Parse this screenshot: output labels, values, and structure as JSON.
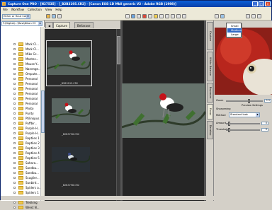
{
  "window": {
    "title": "Capture One PRO - [N27535] - [_B2B3195.CR2] - [Canon EOS-1D Mkll generic V2 - Adobe RGB (1998)]",
    "controls": [
      "_",
      "□",
      "×"
    ]
  },
  "menu": [
    "File",
    "Workflow",
    "Collection",
    "View",
    "Help"
  ],
  "toolbar": {
    "filter_combo": "Either or Hout Call",
    "right_combo": "Medium"
  },
  "left_panel": {
    "path_combo": "F:\\Digital\\...\\Raw\\Nikon 23",
    "folders": [
      "Mark Cl...",
      "Mark Cl...",
      "Mike Gr...",
      "Montes...",
      "Mouse-Y...",
      "Nanenge...",
      "Ompute...",
      "Personal",
      "Personal",
      "Personal",
      "Personal",
      "Personal",
      "Personal",
      "Photo",
      "Purity",
      "Ptilinopus",
      "Puffbir...",
      "Purple H...",
      "Purple H...",
      "Reptiles 1",
      "Reptiles 2",
      "Reptiles 3",
      "Reptiles 4",
      "Reptiles 5",
      "Sahara...",
      "Sandbu...",
      "Sandbu...",
      "Scuglier...",
      "Sunbird...",
      "Spiders a...",
      "Spiders 1",
      "Trekking",
      "Trekking",
      "Wrest N..."
    ]
  },
  "browser": {
    "tabs": [
      "Capture",
      "Bellarase"
    ],
    "thumbnails": [
      {
        "caption": "_B2B3195.CR2",
        "selected": true
      },
      {
        "caption": "_B2B3796.CR2",
        "selected": false
      },
      {
        "caption": "_B2B3798.CR2",
        "selected": false
      }
    ]
  },
  "right_panel": {
    "vertical_tabs": [
      "Capture",
      "White Balance",
      "Exposure",
      "Focus",
      "Develop"
    ],
    "dropdown": {
      "items": [
        "Small",
        "Medium",
        "Large"
      ],
      "highlighted": 1
    },
    "zoom_label": "Zoom",
    "zoom_value": "1:1",
    "sharpening_label": "Sharpening",
    "preview_settings": "Preview Settings",
    "method_label": "Method",
    "method_value": "Standard look",
    "amount_label": "Amount",
    "amount_value": "0",
    "threshold_label": "Threshold",
    "threshold_value": "0"
  },
  "colors": {
    "titlebar": "#0a3fa8",
    "folder": "#f0c850",
    "highlight": "#316ac5",
    "viewer_bg": "#252525"
  }
}
